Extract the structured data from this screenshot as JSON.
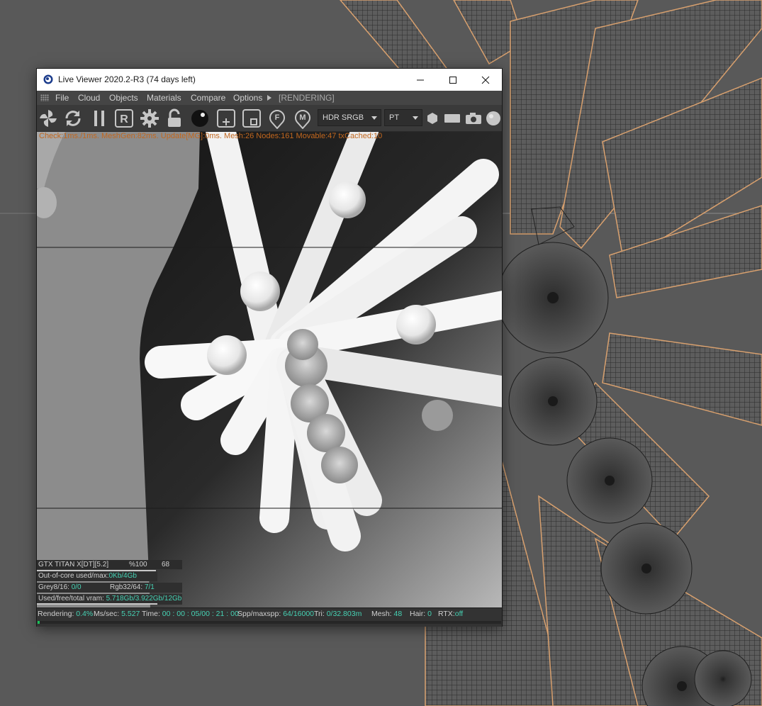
{
  "window": {
    "title": "Live Viewer 2020.2-R3 (74 days left)",
    "controls": {
      "minimize_icon": "minimize-icon",
      "maximize_icon": "maximize-icon",
      "close_icon": "close-icon"
    }
  },
  "menu": {
    "items": [
      "File",
      "Cloud",
      "Objects",
      "Materials",
      "Compare",
      "Options"
    ],
    "status": "[RENDERING]"
  },
  "toolbar": {
    "icons": [
      "octane-logo-icon",
      "refresh-icon",
      "pause-icon",
      "region-r-icon",
      "settings-gear-icon",
      "lock-icon",
      "material-ball-icon",
      "add-icon",
      "frame-icon",
      "f-pin-icon",
      "m-pin-icon"
    ],
    "colorspace": "HDR SRGB",
    "kernel": "PT",
    "extra_icons": [
      "hexagon-icon",
      "rectangle-icon",
      "camera-icon",
      "sphere-icon"
    ]
  },
  "stats_text": "Check:1ms./1ms. MeshGen:82ms. Update[MG]:0ms. Mesh:26 Nodes:161 Movable:47 txCached:10",
  "gpu": {
    "name": "GTX TITAN X[DT][5.2]",
    "usage": "%100",
    "temp": "68"
  },
  "out_of_core": {
    "label": "Out-of-core used/max:",
    "value": "0Kb/4Gb"
  },
  "grey": {
    "label": "Grey8/16:",
    "value": "0/0"
  },
  "rgb": {
    "label": "Rgb32/64:",
    "value": "7/1"
  },
  "vram": {
    "label": "Used/free/total vram:",
    "value": "5.718Gb/3.922Gb/12Gb"
  },
  "status": {
    "rendering_label": "Rendering:",
    "rendering": "0.4%",
    "ms_label": "Ms/sec:",
    "ms": "5.527",
    "time_label": "Time:",
    "time": "00 : 00 : 05/00 : 21 : 00",
    "spp_label": "Spp/maxspp:",
    "spp": "64/16000",
    "tri_label": "Tri:",
    "tri": "0/32.803m",
    "mesh_label": "Mesh:",
    "mesh": "48",
    "hair_label": "Hair:",
    "hair": "0",
    "rtx_label": "RTX:",
    "rtx": "off",
    "progress": 0.004
  },
  "colors": {
    "accent_value": "#46d2b4",
    "stats_orange": "#c2671e",
    "progress_green": "#19c35a"
  }
}
